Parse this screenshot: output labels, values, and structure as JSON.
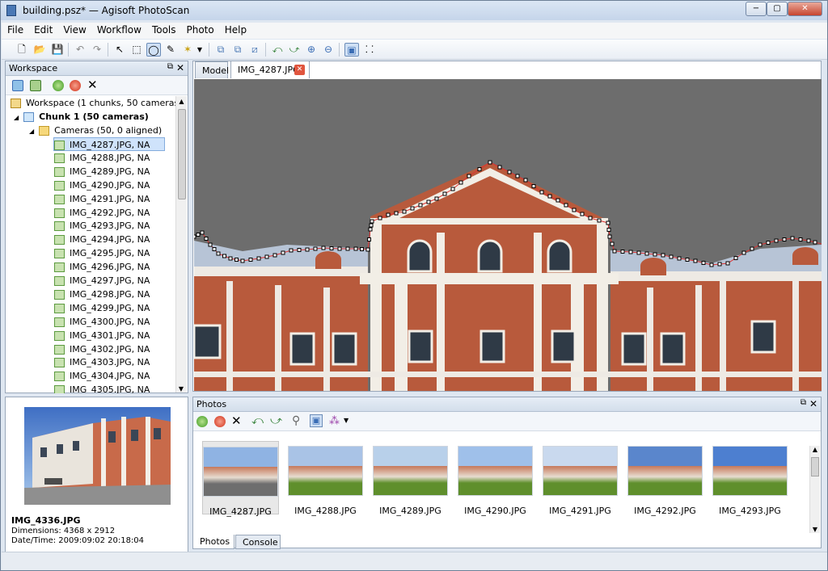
{
  "window": {
    "title": "building.psz* — Agisoft PhotoScan",
    "minimize": "−",
    "maximize": "▢",
    "close": "✕"
  },
  "menu": [
    "File",
    "Edit",
    "View",
    "Workflow",
    "Tools",
    "Photo",
    "Help"
  ],
  "workspace": {
    "header": "Workspace",
    "root": "Workspace (1 chunks, 50 cameras)",
    "chunk": "Chunk 1 (50 cameras)",
    "cameras_folder": "Cameras (50, 0 aligned)",
    "cameras": [
      "IMG_4287.JPG, NA",
      "IMG_4288.JPG, NA",
      "IMG_4289.JPG, NA",
      "IMG_4290.JPG, NA",
      "IMG_4291.JPG, NA",
      "IMG_4292.JPG, NA",
      "IMG_4293.JPG, NA",
      "IMG_4294.JPG, NA",
      "IMG_4295.JPG, NA",
      "IMG_4296.JPG, NA",
      "IMG_4297.JPG, NA",
      "IMG_4298.JPG, NA",
      "IMG_4299.JPG, NA",
      "IMG_4300.JPG, NA",
      "IMG_4301.JPG, NA",
      "IMG_4302.JPG, NA",
      "IMG_4303.JPG, NA",
      "IMG_4304.JPG, NA",
      "IMG_4305.JPG, NA"
    ]
  },
  "preview": {
    "name": "IMG_4336.JPG",
    "dimensions": "Dimensions: 4368 x 2912",
    "datetime": "Date/Time: 2009:09:02 20:18:04"
  },
  "tabs": {
    "model": "Model",
    "image": "IMG_4287.JPG"
  },
  "photos_panel": {
    "header": "Photos",
    "thumbnails": [
      "IMG_4287.JPG",
      "IMG_4288.JPG",
      "IMG_4289.JPG",
      "IMG_4290.JPG",
      "IMG_4291.JPG",
      "IMG_4292.JPG",
      "IMG_4293.JPG"
    ]
  },
  "bottom_tabs": {
    "photos": "Photos",
    "console": "Console"
  },
  "colors": {
    "accent": "#3a6db5",
    "selection": "#cfe3fb",
    "mask_line": "#e03030",
    "brick": "#b85a3c"
  }
}
